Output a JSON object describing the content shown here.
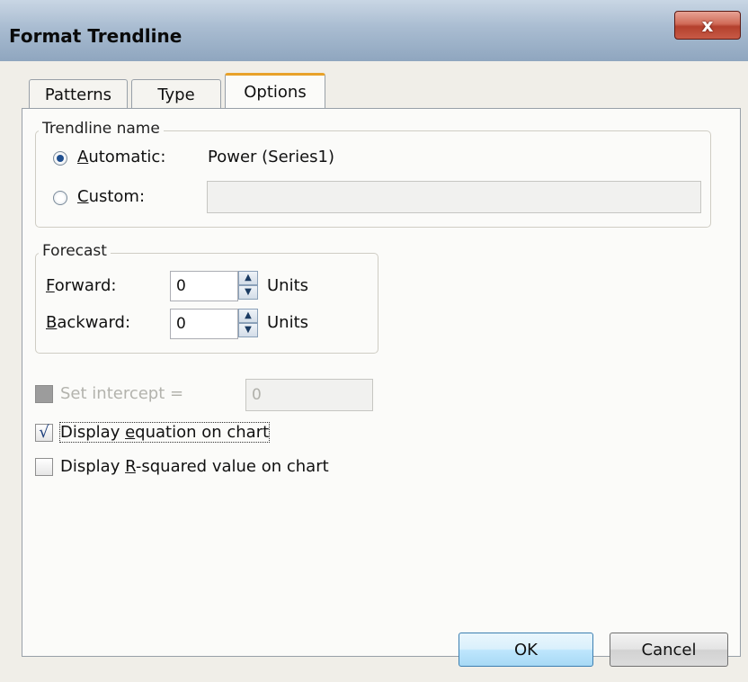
{
  "window": {
    "title": "Format Trendline",
    "close_label": "x"
  },
  "tabs": [
    {
      "label": "Patterns",
      "active": false
    },
    {
      "label": "Type",
      "active": false
    },
    {
      "label": "Options",
      "active": true
    }
  ],
  "trendline_name": {
    "legend": "Trendline name",
    "automatic": {
      "label_first": "A",
      "label_rest": "utomatic:",
      "value": "Power (Series1)",
      "selected": true
    },
    "custom": {
      "label_first": "C",
      "label_rest": "ustom:",
      "value": "",
      "selected": false
    }
  },
  "forecast": {
    "legend": "Forecast",
    "forward": {
      "label_first": "F",
      "label_rest": "orward:",
      "value": "0",
      "units": "Units"
    },
    "backward": {
      "label_first": "B",
      "label_rest": "ackward:",
      "value": "0",
      "units": "Units"
    }
  },
  "set_intercept": {
    "label": "Set intercept =",
    "value": "0",
    "checked": false,
    "disabled": true
  },
  "display_equation": {
    "label_pre": "Display ",
    "label_key": "e",
    "label_post": "quation on chart",
    "checked": true,
    "check_glyph": "√"
  },
  "display_r_squared": {
    "label_pre": "Display ",
    "label_key": "R",
    "label_post": "-squared value on chart",
    "checked": false
  },
  "buttons": {
    "ok": "OK",
    "cancel": "Cancel"
  },
  "colors": {
    "tab_highlight": "#e8a22a",
    "default_button": "#a7d9f5",
    "close_button": "#c75a46"
  }
}
